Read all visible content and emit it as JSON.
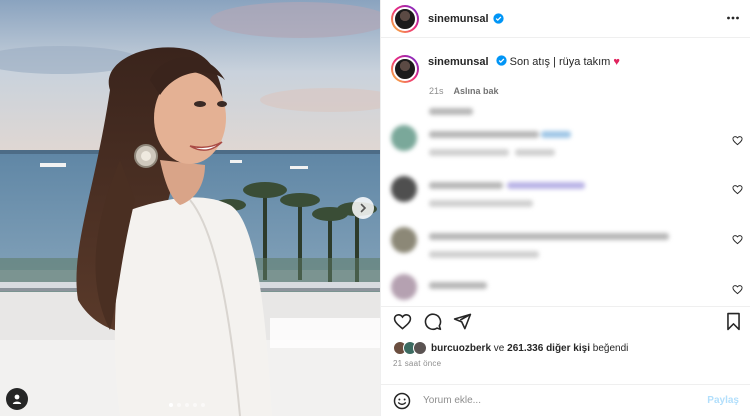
{
  "post": {
    "username": "sinemunsal",
    "caption": "Son atış | rüya takım",
    "caption_emoji": "♥",
    "time_short": "21s",
    "translate_label": "Aslına bak",
    "like_user": "burcuozberk",
    "likes_connector": "ve",
    "likes_count_text": "261.336 diğer kişi",
    "likes_suffix": "beğendi",
    "time_long": "21 saat önce",
    "comment_placeholder": "Yorum ekle...",
    "post_button": "Paylaş",
    "carousel_total": 5,
    "carousel_active": 0
  },
  "colors": {
    "verified": "#0095f6",
    "heart": "#e0245e",
    "post_button_disabled": "#b2dffc"
  },
  "icons": [
    "verified-badge-icon",
    "more-options-icon",
    "like-icon",
    "comment-icon",
    "share-icon",
    "save-icon",
    "emoji-icon",
    "chevron-right-icon",
    "user-tag-icon"
  ]
}
